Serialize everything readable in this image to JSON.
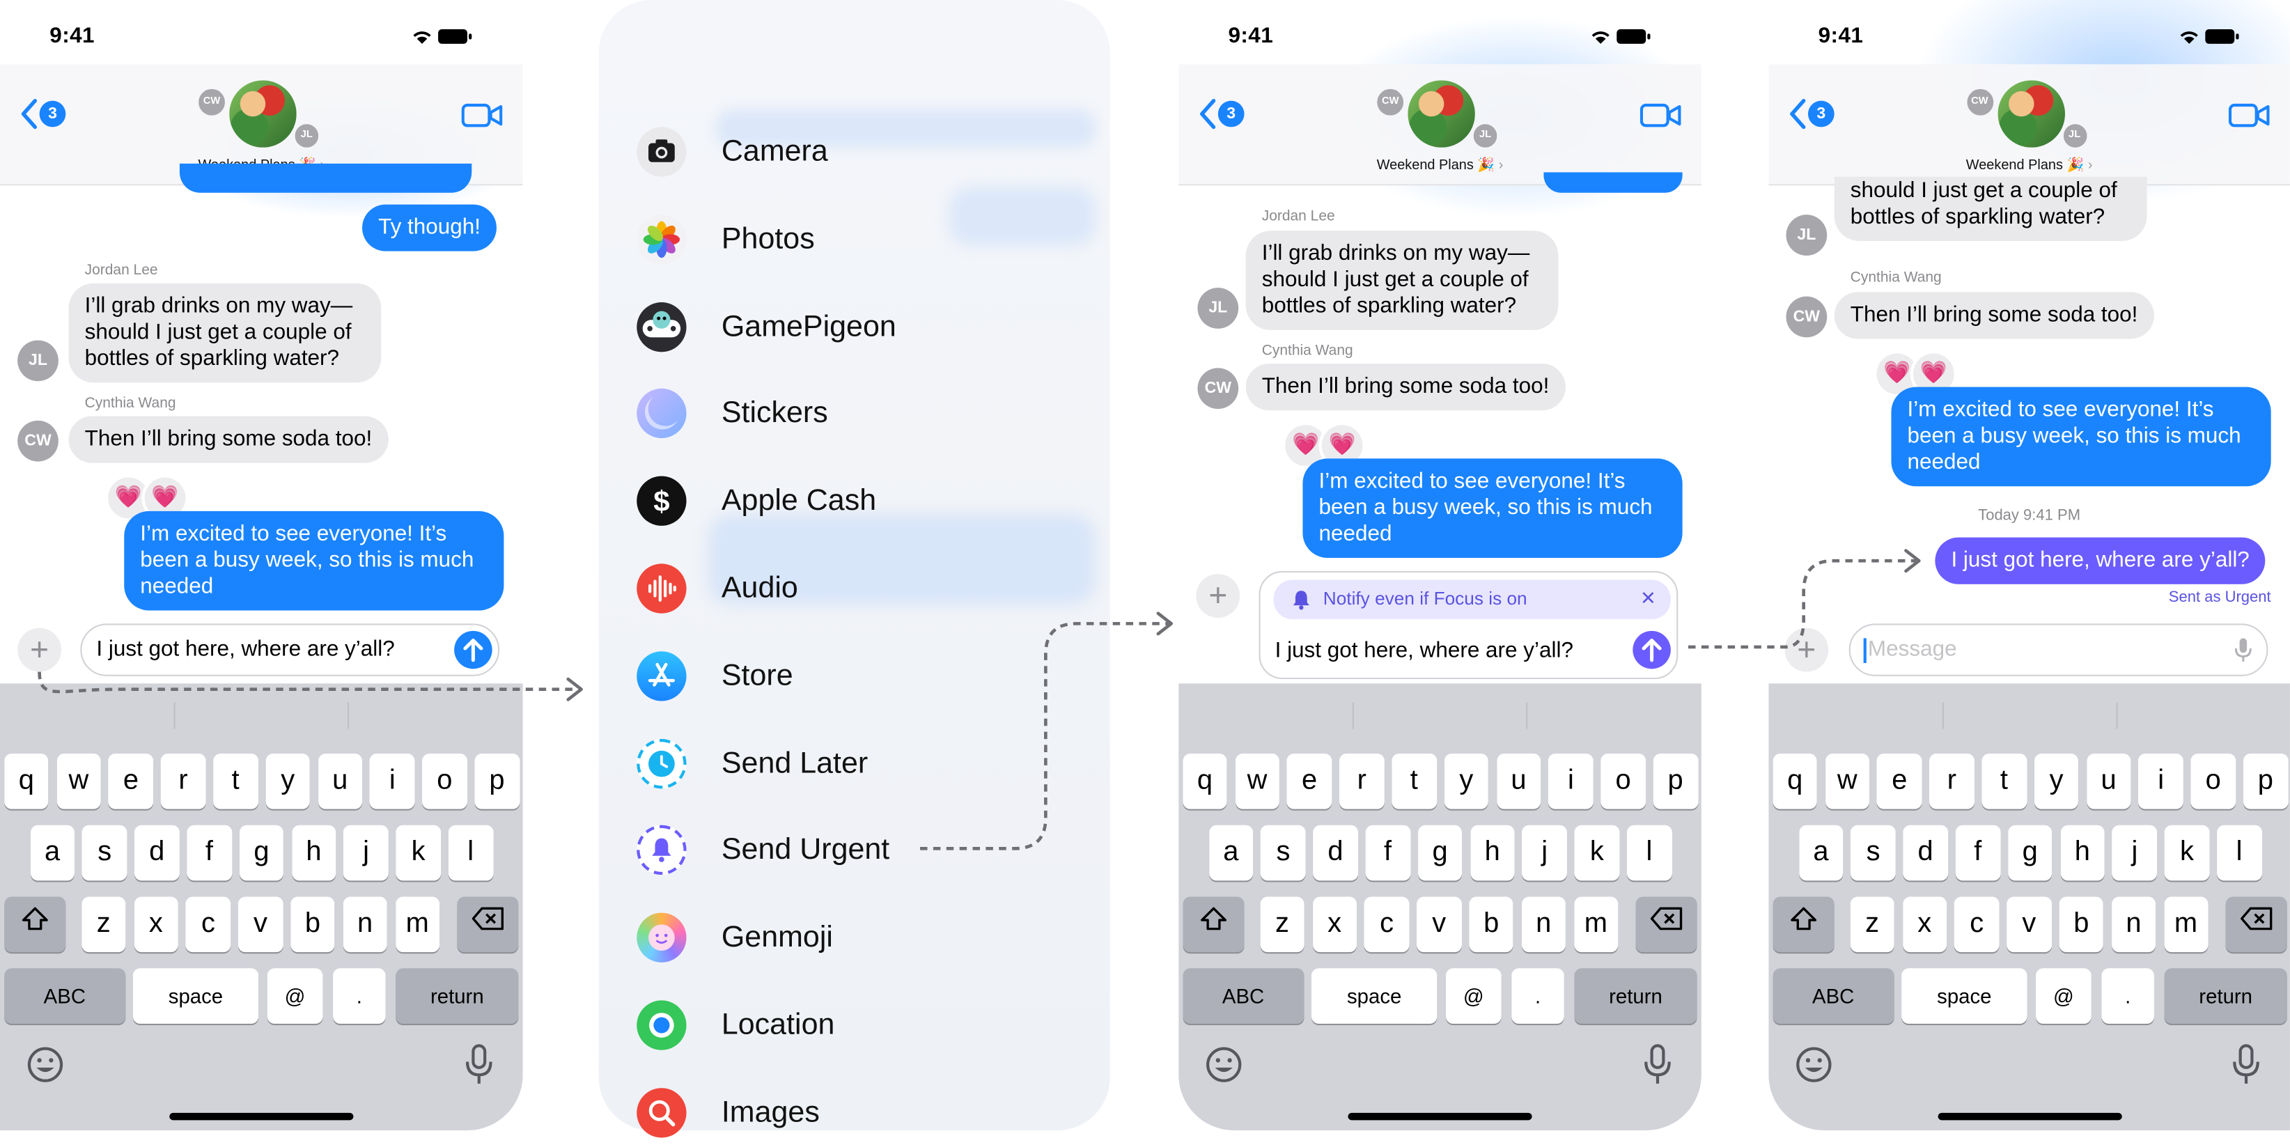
{
  "status": {
    "time": "9:41"
  },
  "header": {
    "back_count": "3",
    "group_name": "Weekend Plans 🎉",
    "chevron": "›",
    "avatar_cw": "CW",
    "avatar_jl": "JL"
  },
  "chat": {
    "partial_me": "Ty though!",
    "jordan_name": "Jordan Lee",
    "jordan_msg_1": "I’ll grab drinks on my way—",
    "jordan_msg_2": "should I just get a couple of",
    "jordan_msg_3": "bottles of sparkling water?",
    "cynthia_name": "Cynthia Wang",
    "cynthia_msg": "Then I’ll bring some soda too!",
    "my_msg_1": "I’m excited to see everyone! It’s",
    "my_msg_2": "been a busy week, so this is much",
    "my_msg_3": "needed",
    "heart_icon": "💗",
    "draft": "I just got here, where are y’all?",
    "timestamp": "Today 9:41 PM",
    "sent_as": "Sent as Urgent",
    "placeholder": "Message"
  },
  "notify_banner": {
    "label": "Notify even if Focus is on",
    "close": "✕"
  },
  "menu": {
    "items": [
      {
        "label": "Camera",
        "icon": "camera-icon"
      },
      {
        "label": "Photos",
        "icon": "photos-icon"
      },
      {
        "label": "GamePigeon",
        "icon": "gamepigeon-icon"
      },
      {
        "label": "Stickers",
        "icon": "stickers-icon"
      },
      {
        "label": "Apple Cash",
        "icon": "apple-cash-icon"
      },
      {
        "label": "Audio",
        "icon": "audio-icon"
      },
      {
        "label": "Store",
        "icon": "store-icon"
      },
      {
        "label": "Send Later",
        "icon": "clock-icon"
      },
      {
        "label": "Send Urgent",
        "icon": "bell-icon"
      },
      {
        "label": "Genmoji",
        "icon": "genmoji-icon"
      },
      {
        "label": "Location",
        "icon": "location-icon"
      },
      {
        "label": "Images",
        "icon": "images-icon"
      }
    ]
  },
  "keyboard": {
    "row1": [
      "q",
      "w",
      "e",
      "r",
      "t",
      "y",
      "u",
      "i",
      "o",
      "p"
    ],
    "row2": [
      "a",
      "s",
      "d",
      "f",
      "g",
      "h",
      "j",
      "k",
      "l"
    ],
    "row3": [
      "z",
      "x",
      "c",
      "v",
      "b",
      "n",
      "m"
    ],
    "abc": "ABC",
    "space": "space",
    "at": "@",
    "dot": ".",
    "return": "return"
  },
  "colors": {
    "accent": "#1a84ff",
    "urgent": "#6b5cff",
    "bubble_gray": "#e9e9eb",
    "keyboard": "#d1d3d9"
  }
}
